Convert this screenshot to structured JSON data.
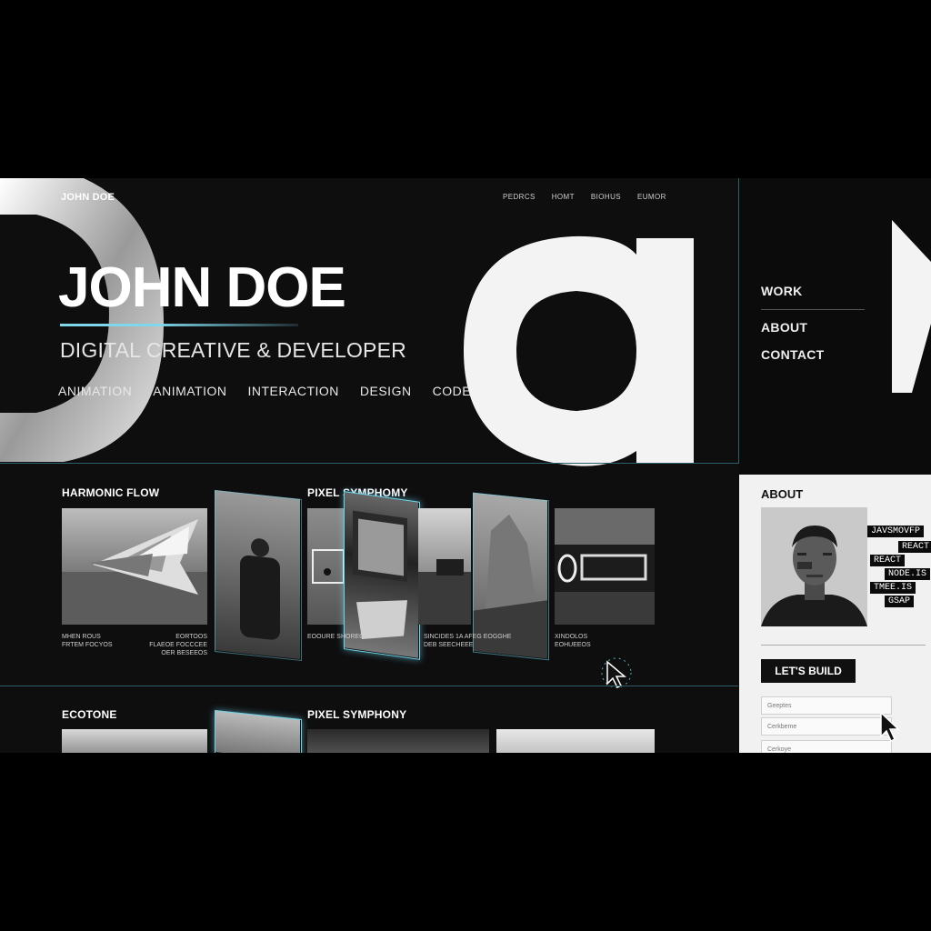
{
  "brand": "JOHN DOE",
  "top_nav": [
    "PEDRCS",
    "HOMT",
    "BIOHUS",
    "EUMOR"
  ],
  "hero": {
    "title": "JOHN DOE",
    "subtitle": "DIGITAL CREATIVE & DEVELOPER",
    "tags": [
      "ANIMATION",
      "ANIMATION",
      "INTERACTION",
      "DESIGN",
      "CODE"
    ]
  },
  "side_nav": [
    "WORK",
    "ABOUT",
    "CONTACT"
  ],
  "projects": {
    "row1": {
      "left_title": "HARMONIC FLOW",
      "right_title": "PIXEL SYMPHOMY",
      "captions": {
        "c1": "MHEN ROUS\nFRTEM FOCYOS",
        "c2": "EORTOOS\nFLAEOE FOCCCEE\nOER BESEEOS",
        "c3": "EOOURE SHOREOT",
        "c4": "SINCIDES 1A AFEG EOGGHE\nDEB SEECHEEE",
        "c5": "XINDOLOS\nEOHUEEOS"
      }
    },
    "row2": {
      "left_title": "ECOTONE",
      "right_title": "PIXEL SYMPHONY"
    }
  },
  "about": {
    "heading": "ABOUT",
    "skills": [
      "JAVSMOVFP",
      "REACT",
      "REACT",
      "NODE.IS",
      "TMEE.IS",
      "GSAP"
    ],
    "cta": "LET'S BUILD",
    "fields": [
      "Geeptes",
      "Cerkbeme",
      "Cerkoye"
    ]
  },
  "colors": {
    "accent": "#6fd4ea",
    "bg": "#0e0e0f",
    "panel_light": "#f1f1f1"
  }
}
